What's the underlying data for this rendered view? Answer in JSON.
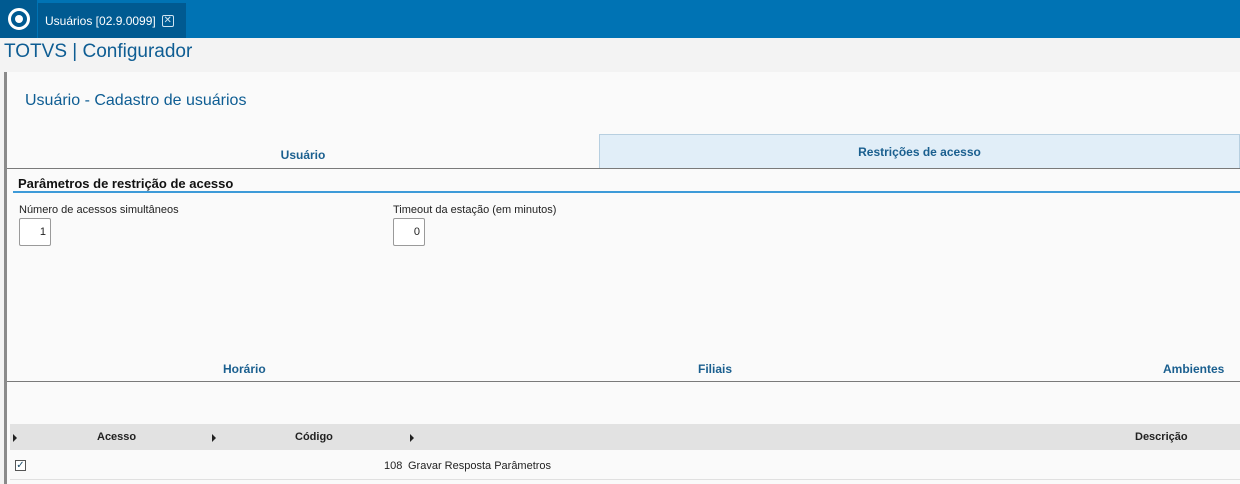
{
  "window": {
    "tab_title": "Usuários [02.9.0099]",
    "tab_close_glyph": "✕",
    "app_title": "TOTVS | Configurador",
    "logo_icon": "totvs-logo-icon"
  },
  "page": {
    "title": "Usuário - Cadastro de usuários"
  },
  "tabs": [
    {
      "label": "Usuário",
      "active": false
    },
    {
      "label": "Restrições de acesso",
      "active": true
    }
  ],
  "section": {
    "title": "Parâmetros de restrição de acesso"
  },
  "fields": {
    "simultaneous_access": {
      "label": "Número de acessos simultâneos",
      "value": "1"
    },
    "station_timeout": {
      "label": "Timeout da estação (em minutos)",
      "value": "0"
    }
  },
  "subtabs": [
    {
      "label": "Horário"
    },
    {
      "label": "Filiais"
    },
    {
      "label": "Ambientes"
    }
  ],
  "grid": {
    "columns": [
      "Acesso",
      "Código",
      "Descrição"
    ],
    "rows": [
      {
        "acesso": true,
        "codigo": "108",
        "descricao": "Gravar Resposta Parâmetros"
      }
    ]
  },
  "colors": {
    "topbar": "#0073b4",
    "accent": "#0e5d93",
    "active_tab": "#e1eef8",
    "section_line": "#3d9ad8"
  }
}
